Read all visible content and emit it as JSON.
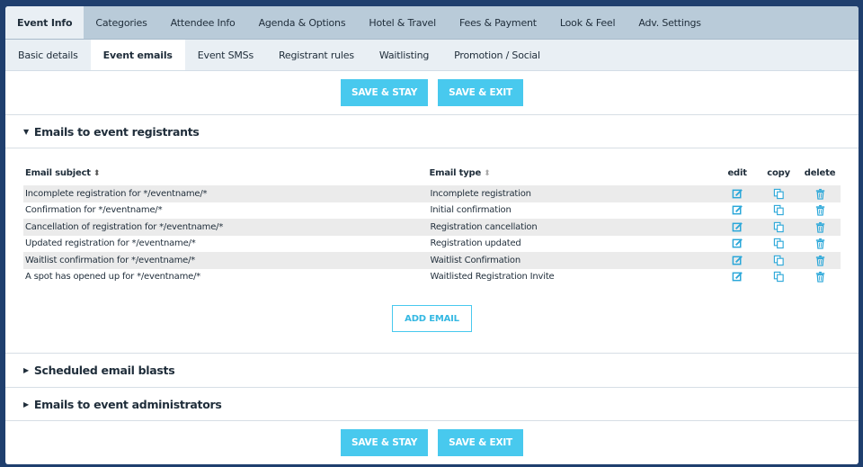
{
  "main_tabs": [
    "Event Info",
    "Categories",
    "Attendee Info",
    "Agenda & Options",
    "Hotel & Travel",
    "Fees & Payment",
    "Look & Feel",
    "Adv. Settings"
  ],
  "sub_tabs": [
    "Basic details",
    "Event emails",
    "Event SMSs",
    "Registrant rules",
    "Waitlisting",
    "Promotion / Social"
  ],
  "buttons": {
    "save_stay": "SAVE & STAY",
    "save_exit": "SAVE & EXIT",
    "add_email": "ADD EMAIL"
  },
  "sections": {
    "registrants": "Emails to event registrants",
    "blasts": "Scheduled email blasts",
    "admins": "Emails to event administrators"
  },
  "table": {
    "headers": {
      "subject": "Email subject",
      "type": "Email type",
      "edit": "edit",
      "copy": "copy",
      "delete": "delete"
    },
    "rows": [
      {
        "subject": "Incomplete registration for */eventname/*",
        "type": "Incomplete registration"
      },
      {
        "subject": "Confirmation for */eventname/*",
        "type": "Initial confirmation"
      },
      {
        "subject": "Cancellation of registration for */eventname/*",
        "type": "Registration cancellation"
      },
      {
        "subject": "Updated registration for */eventname/*",
        "type": "Registration updated"
      },
      {
        "subject": "Waitlist confirmation for */eventname/*",
        "type": "Waitlist Confirmation"
      },
      {
        "subject": "A spot has opened up for */eventname/*",
        "type": "Waitlisted Registration Invite"
      }
    ]
  },
  "colors": {
    "accent": "#48c9ee",
    "tabbar": "#b9cbd9",
    "icon": "#2aa7d9"
  }
}
